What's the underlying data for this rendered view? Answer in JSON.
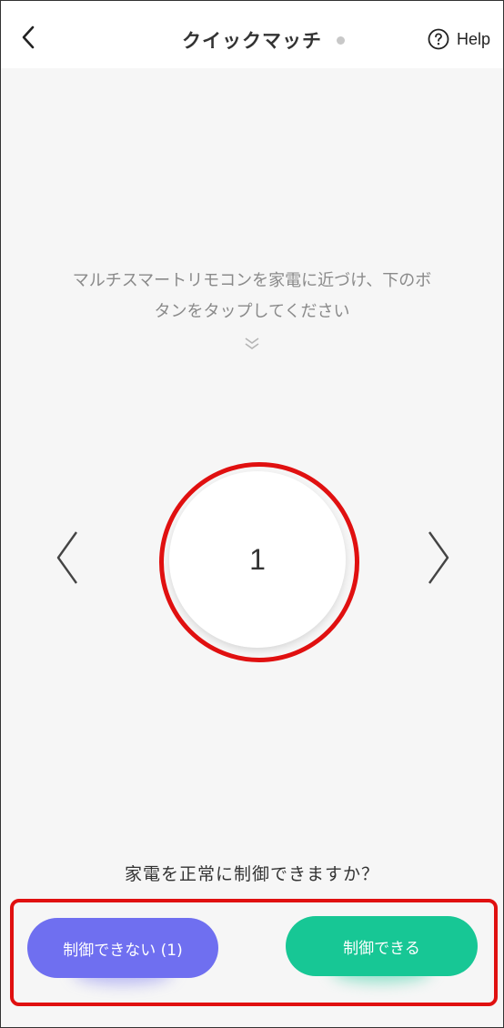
{
  "header": {
    "title": "クイックマッチ",
    "help_label": "Help"
  },
  "instruction": {
    "line1": "マルチスマートリモコンを家電に近づけ、下のボ",
    "line2": "タンをタップしてください"
  },
  "selector": {
    "current_number": "1"
  },
  "question": "家電を正常に制御できますか？",
  "buttons": {
    "fail_label": "制御できない (1)",
    "ok_label": "制御できる"
  },
  "colors": {
    "fail_button": "#6f6ff0",
    "ok_button": "#17c795",
    "highlight": "#e01010"
  },
  "icons": {
    "back": "chevron-left-icon",
    "help": "question-circle-icon",
    "scroll_hint": "double-chevron-down-icon",
    "prev": "chevron-left-icon",
    "next": "chevron-right-icon"
  }
}
